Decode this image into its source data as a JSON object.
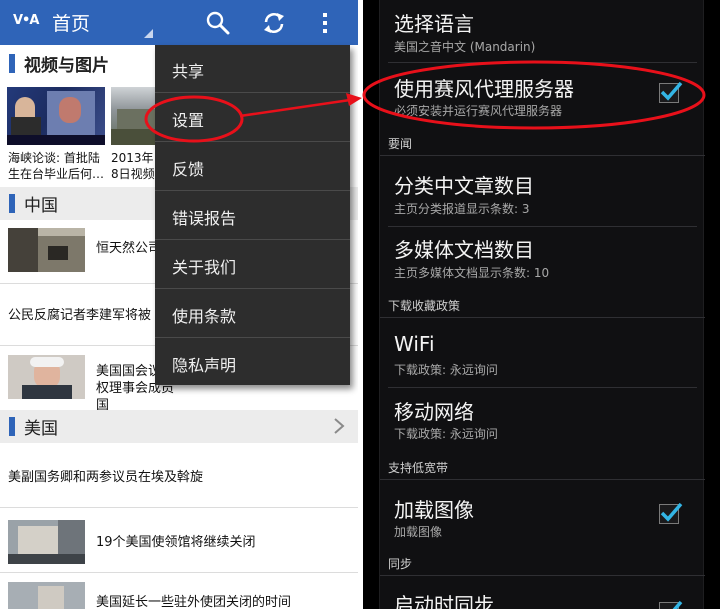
{
  "left": {
    "actionbar": {
      "logo": "V•A",
      "title": "首页",
      "icons": [
        "search-icon",
        "refresh-icon",
        "overflow-menu-icon"
      ],
      "color": "#2f64b8"
    },
    "sections": [
      {
        "title": "视频与图片"
      },
      {
        "title": "中国"
      },
      {
        "title": "美国"
      }
    ],
    "media": [
      {
        "caption": "海峡论谈: 首批陆生在台毕业后何…"
      },
      {
        "caption": "2013年8日视频新"
      }
    ],
    "news_china": [
      {
        "title": "恒天然公司"
      },
      {
        "title": "公民反腐记者李建军将被"
      },
      {
        "title": "美国国会议人权理事会成员国"
      }
    ],
    "news_us": [
      {
        "title": "美副国务卿和两参议员在埃及斡旋"
      },
      {
        "title": "19个美国使领馆将继续关闭"
      },
      {
        "title": "美国延长一些驻外使团关闭的时间"
      }
    ],
    "menu": [
      "共享",
      "设置",
      "反馈",
      "错误报告",
      "关于我们",
      "使用条款",
      "隐私声明"
    ]
  },
  "right": {
    "items": [
      {
        "title": "选择语言",
        "summary": "美国之音中文 (Mandarin)"
      },
      {
        "title": "使用赛风代理服务器",
        "summary": "必须安装并运行赛风代理服务器",
        "checked": true
      },
      {
        "category": "要闻"
      },
      {
        "title": "分类中文章数目",
        "summary": "主页分类报道显示条数: 3"
      },
      {
        "title": "多媒体文档数目",
        "summary": "主页多媒体文档显示条数: 10"
      },
      {
        "category": "下载收藏政策"
      },
      {
        "title": "WiFi",
        "summary": "下载政策: 永远询问"
      },
      {
        "title": "移动网络",
        "summary": "下载政策: 永远询问"
      },
      {
        "category": "支持低宽带"
      },
      {
        "title": "加载图像",
        "summary": "加载图像",
        "checked": true
      },
      {
        "category": "同步"
      },
      {
        "title": "启动时同步",
        "checked": true
      }
    ],
    "accent_check": "#33b5e5"
  },
  "annotation_color": "#e8101a"
}
